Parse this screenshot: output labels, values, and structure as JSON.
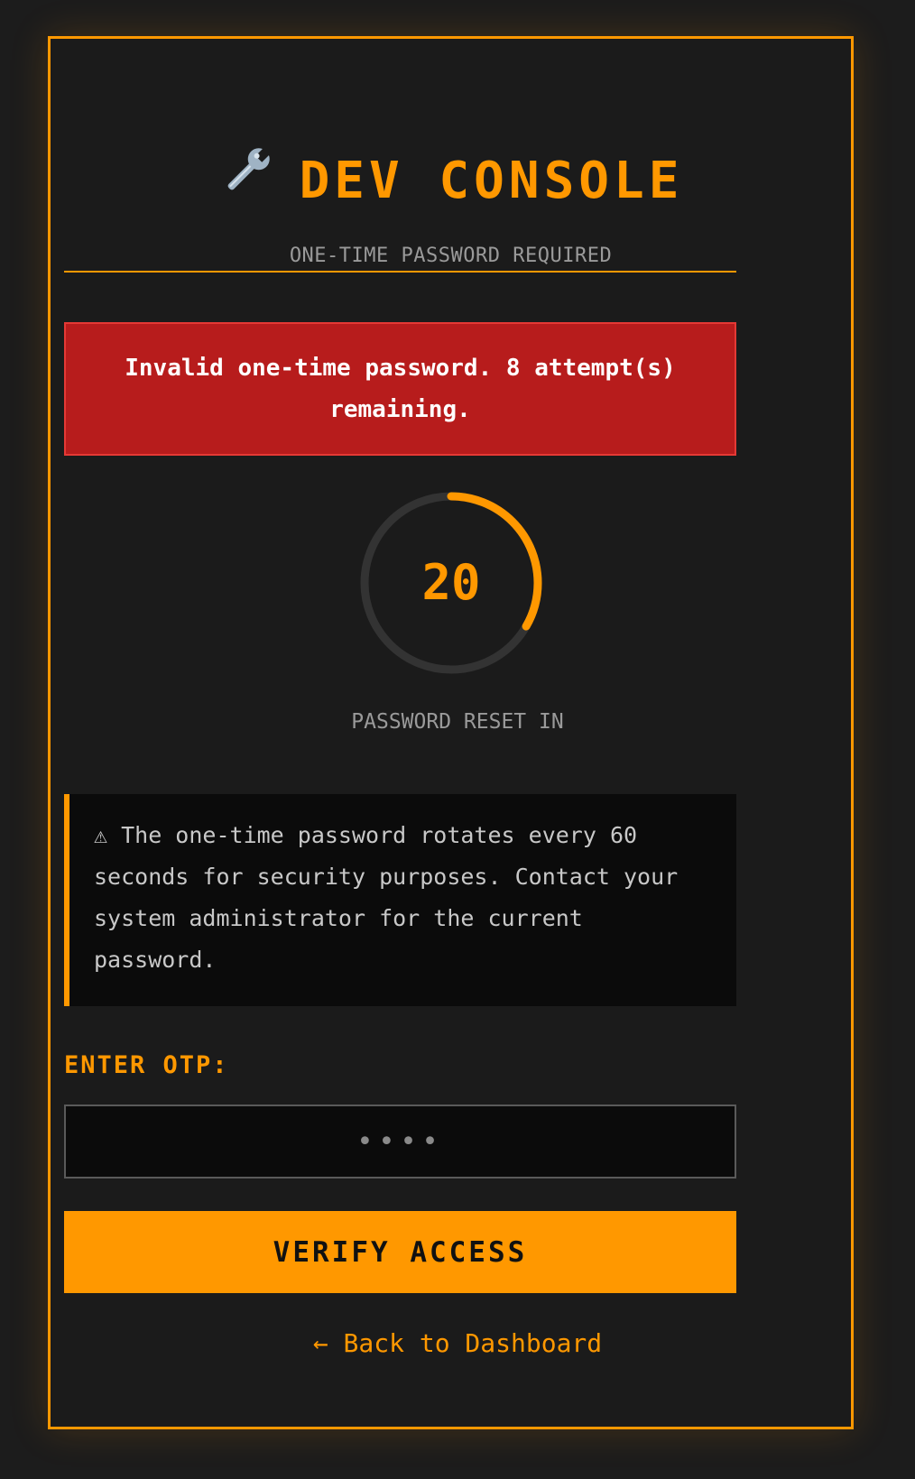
{
  "header": {
    "icon": "wrench-icon",
    "icon_glyph": "🔧",
    "title": "DEV CONSOLE",
    "subtitle": "ONE-TIME PASSWORD REQUIRED"
  },
  "alert": {
    "message": "Invalid one-time password. 8 attempt(s) remaining."
  },
  "timer": {
    "seconds_remaining": "20",
    "total_seconds": 60,
    "label": "PASSWORD RESET IN"
  },
  "notice": {
    "icon": "warning-icon",
    "text": "⚠ The one-time password rotates every 60 seconds for security purposes. Contact your system administrator for the current password."
  },
  "form": {
    "otp_label": "ENTER OTP:",
    "otp_placeholder": "••••",
    "otp_value": "",
    "submit_label": "VERIFY ACCESS"
  },
  "nav": {
    "back_label": "← Back to Dashboard"
  },
  "colors": {
    "accent": "#ff9800",
    "background": "#1b1b1b",
    "error": "#b71c1c",
    "track": "#333333"
  }
}
